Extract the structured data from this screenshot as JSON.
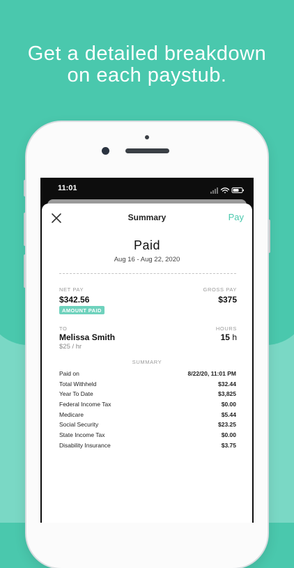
{
  "headline": {
    "line1": "Get a detailed breakdown",
    "line2": "on each paystub."
  },
  "status_bar": {
    "time": "11:01"
  },
  "nav": {
    "title": "Summary",
    "action": "Pay"
  },
  "paystub": {
    "status": "Paid",
    "date_range": "Aug 16 - Aug 22, 2020",
    "net_pay_label": "NET PAY",
    "net_pay": "$342.56",
    "gross_pay_label": "GROSS PAY",
    "gross_pay": "$375",
    "badge": "AMOUNT PAID",
    "to_label": "TO",
    "recipient": "Melissa Smith",
    "rate": "$25 / hr",
    "hours_label": "HOURS",
    "hours_value": "15",
    "hours_unit": " h",
    "summary_label": "SUMMARY",
    "rows": [
      {
        "label": "Paid on",
        "value": "8/22/20, 11:01 PM"
      },
      {
        "label": "Total Withheld",
        "value": "$32.44"
      },
      {
        "label": "Year To Date",
        "value": "$3,825"
      },
      {
        "label": "Federal Income Tax",
        "value": "$0.00"
      },
      {
        "label": "Medicare",
        "value": "$5.44"
      },
      {
        "label": "Social Security",
        "value": "$23.25"
      },
      {
        "label": "State Income Tax",
        "value": "$0.00"
      },
      {
        "label": "Disability Insurance",
        "value": "$3.75"
      }
    ]
  },
  "colors": {
    "brand": "#4ac8ad",
    "brand_light": "#7ad8c5",
    "badge": "#6fd2bd"
  }
}
